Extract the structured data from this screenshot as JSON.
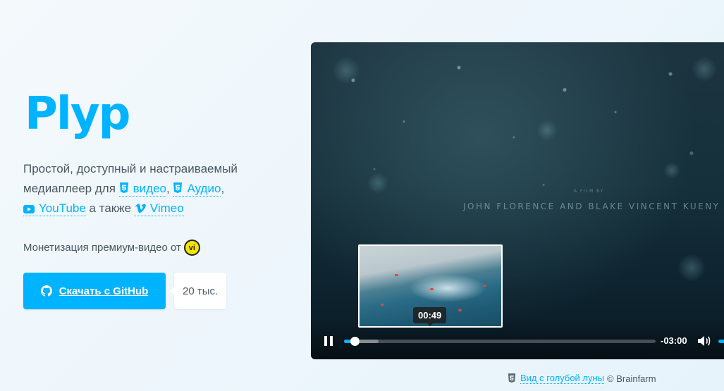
{
  "brand": {
    "name": "Plyp",
    "color": "#00b3ff"
  },
  "tagline": {
    "line1": "Простой, доступный и настраиваемый",
    "prefix": "медиаплеер для",
    "video_link": "видео",
    "comma1": ",",
    "audio_link": "Аудио",
    "comma2": ",",
    "youtube_link": "YouTube",
    "also": "а также",
    "vimeo_link": "Vimeo"
  },
  "monetization": {
    "text": "Монетизация премиум-видео от",
    "badge": "vi"
  },
  "cta": {
    "github_label": "Скачать с GitHub",
    "stars_count": "20 тыс."
  },
  "player": {
    "credit_small": "A FILM BY",
    "credit_names": "JOHN FLORENCE AND BLAKE VINCENT KUENY",
    "preview_time": "00:49",
    "time_remaining": "-03:00",
    "progress_fraction": 0.02,
    "buffered_fraction": 0.11,
    "hover_fraction": 0.28,
    "volume_fraction": 1.0
  },
  "caption": {
    "link": "Вид с голубой луны",
    "suffix": "© Brainfarm"
  },
  "icons": {
    "html5": "html5-icon",
    "youtube": "youtube-icon",
    "vimeo": "vimeo-icon",
    "github": "github-icon",
    "pause": "pause-icon",
    "volume": "volume-icon"
  }
}
